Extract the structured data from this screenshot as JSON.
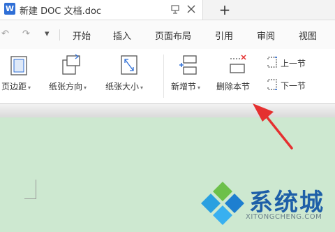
{
  "titlebar": {
    "doc_icon_letter": "W",
    "tab_title": "新建 DOC 文档.doc",
    "new_tab_label": "+"
  },
  "menubar": {
    "undo_symbol": "↶",
    "redo_symbol": "↷",
    "dropdown_symbol": "▾",
    "items": [
      "开始",
      "插入",
      "页面布局",
      "引用",
      "审阅",
      "视图"
    ]
  },
  "ribbon": {
    "margins_label": "页边距",
    "orientation_label": "纸张方向",
    "size_label": "纸张大小",
    "add_section_label": "新增节",
    "delete_section_label": "删除本节",
    "prev_section_label": "上一节",
    "next_section_label": "下一节",
    "caret": "▾"
  },
  "watermark": {
    "title": "系统城",
    "subtitle": "XITONGCHENG.COM"
  },
  "colors": {
    "doc_background": "#cde8d0",
    "accent_blue": "#2f6fd6",
    "arrow_red": "#e53030"
  }
}
